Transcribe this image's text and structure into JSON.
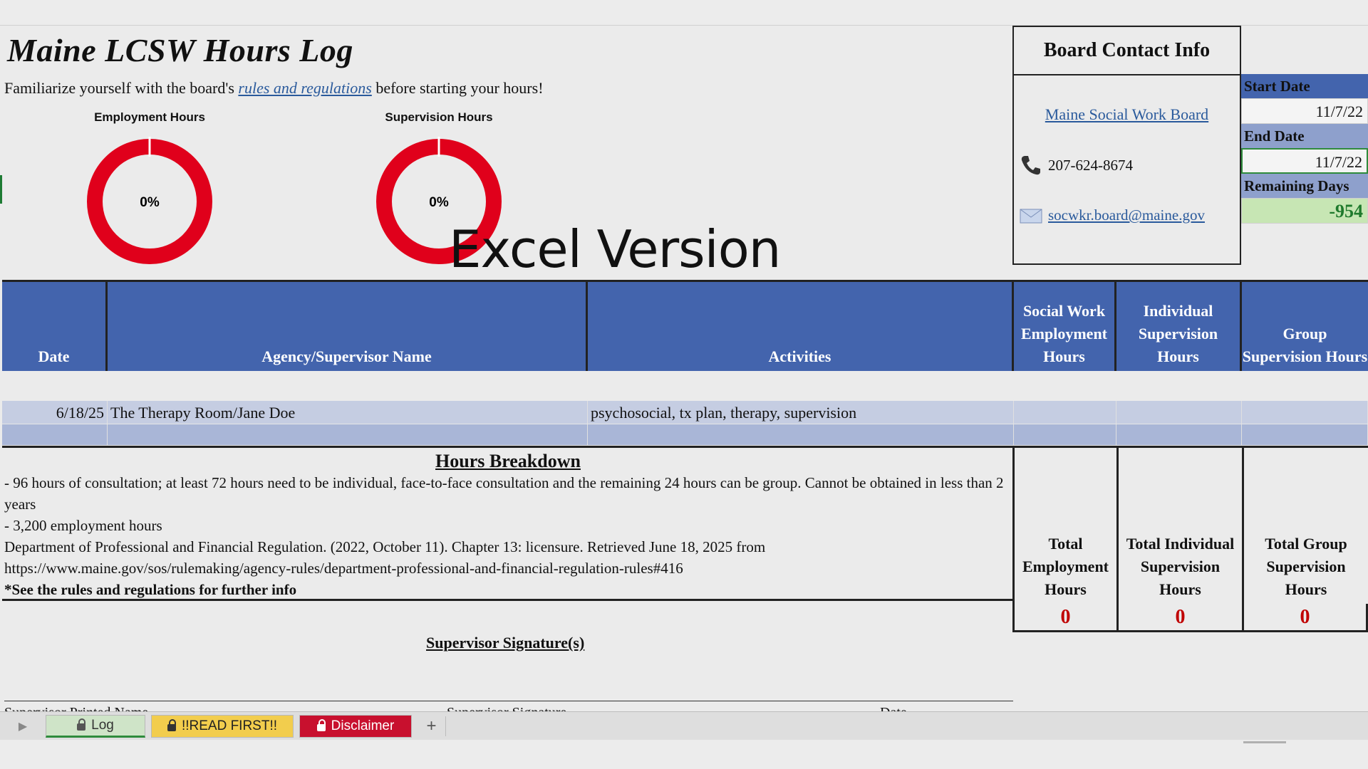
{
  "title": "Maine LCSW Hours Log",
  "intro": {
    "before": "Familiarize yourself with the board's ",
    "link": "rules and regulations",
    "after": " before starting your hours!"
  },
  "charts": [
    {
      "title": "Employment Hours",
      "value_label": "0%",
      "fraction": 0
    },
    {
      "title": "Supervision Hours",
      "value_label": "0%",
      "fraction": 0
    }
  ],
  "chart_colors": {
    "ring": "#e0001b",
    "progress": "#2f8b3c",
    "gap": "#ffffff"
  },
  "watermark": "Excel Version",
  "contact": {
    "heading": "Board Contact Info",
    "board_link": "Maine Social Work Board",
    "phone": "207-624-8674",
    "email": "socwkr.board@maine.gov"
  },
  "dates": {
    "start_label": "Start Date",
    "start_value": "11/7/22",
    "end_label": "End Date",
    "end_value": "11/7/22",
    "remaining_label": "Remaining Days",
    "remaining_value": "-954"
  },
  "table": {
    "headers": [
      {
        "text": "Date"
      },
      {
        "text": "Agency/Supervisor Name"
      },
      {
        "text": "Activities"
      },
      {
        "text": "Social Work Employment Hours"
      },
      {
        "text": "Individual Supervision Hours"
      },
      {
        "text": "Group Supervision Hours"
      }
    ],
    "rows": [
      [
        "6/18/25",
        "The Therapy Room/Jane Doe",
        "psychosocial, tx plan, therapy, supervision",
        "",
        "",
        ""
      ],
      [
        "",
        "",
        "",
        "",
        "",
        ""
      ]
    ]
  },
  "breakdown": {
    "heading": "Hours Breakdown",
    "lines": [
      "- 96 hours of consultation; at least 72 hours need to be individual, face-to-face consultation and the remaining 24 hours can be group. Cannot be obtained in less than 2 years",
      "- 3,200 employment hours",
      "Department of Professional and Financial Regulation. (2022, October 11). Chapter 13: licensure. Retrieved June 18, 2025 from https://www.maine.gov/sos/rulemaking/agency-rules/department-professional-and-financial-regulation-rules#416"
    ],
    "note": "*See the rules and regulations for further info"
  },
  "totals": [
    {
      "label": "Total Employment Hours",
      "value": "0"
    },
    {
      "label": "Total Individual Supervision Hours",
      "value": "0"
    },
    {
      "label": "Total Group Supervision Hours",
      "value": "0"
    }
  ],
  "signature": {
    "heading": "Supervisor Signature(s)",
    "printed_name": "Supervisor Printed Name",
    "signature": "Supervisor Signature",
    "date": "Date"
  },
  "tabs": [
    {
      "label": "Log",
      "color": "#cfe4c8"
    },
    {
      "label": "!!READ FIRST!!",
      "color": "#f2cd4d"
    },
    {
      "label": "Disclaimer",
      "color": "#c8102e"
    }
  ],
  "tab_add": "+"
}
